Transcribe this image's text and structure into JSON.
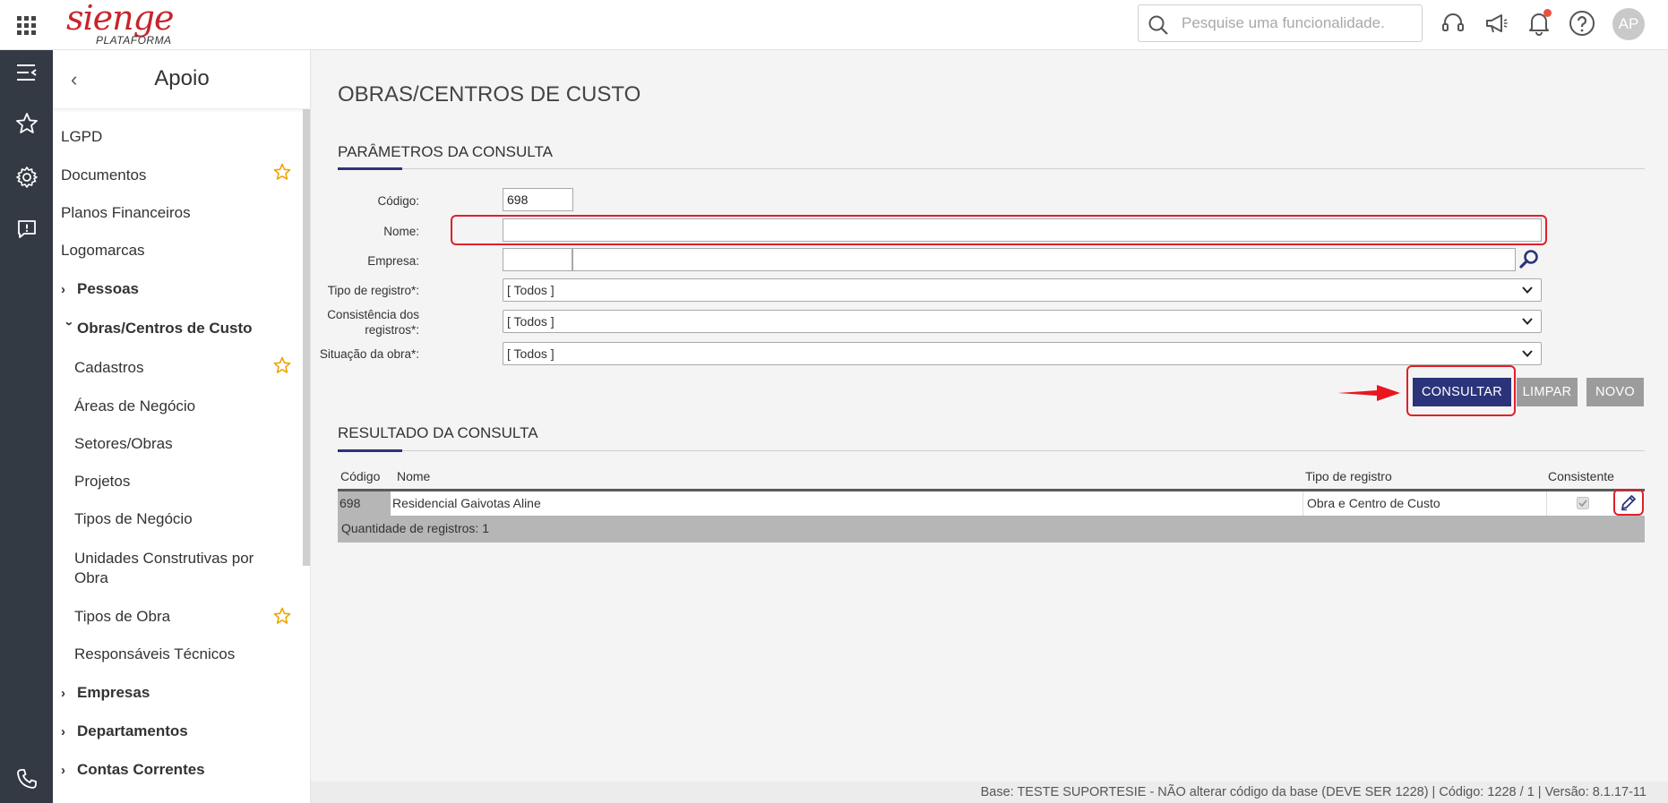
{
  "header": {
    "logo_main": "sienge",
    "logo_sub": "PLATAFORMA",
    "search_placeholder": "Pesquise uma funcionalidade.",
    "avatar_initials": "AP"
  },
  "sidemenu": {
    "title": "Apoio",
    "items": [
      {
        "label": "LGPD"
      },
      {
        "label": "Documentos"
      },
      {
        "label": "Planos Financeiros"
      },
      {
        "label": "Logomarcas"
      },
      {
        "label": "Pessoas"
      },
      {
        "label": "Obras/Centros de Custo"
      },
      {
        "label": "Cadastros"
      },
      {
        "label": "Áreas de Negócio"
      },
      {
        "label": "Setores/Obras"
      },
      {
        "label": "Projetos"
      },
      {
        "label": "Tipos de Negócio"
      },
      {
        "label": "Unidades Construtivas por"
      },
      {
        "label": "Obra"
      },
      {
        "label": "Tipos de Obra"
      },
      {
        "label": "Responsáveis Técnicos"
      },
      {
        "label": "Empresas"
      },
      {
        "label": "Departamentos"
      },
      {
        "label": "Contas Correntes"
      }
    ]
  },
  "main": {
    "page_title": "OBRAS/CENTROS DE CUSTO",
    "params_title": "PARÂMETROS DA CONSULTA",
    "fields": {
      "codigo_label": "Código:",
      "codigo_value": "698",
      "nome_label": "Nome:",
      "nome_value": "",
      "empresa_label": "Empresa:",
      "tipo_registro_label": "Tipo de registro*:",
      "tipo_registro_value": "[ Todos ]",
      "consistencia_label_1": "Consistência dos",
      "consistencia_label_2": "registros*:",
      "consistencia_value": "[ Todos ]",
      "situacao_label": "Situação da obra*:",
      "situacao_value": "[ Todos ]"
    },
    "buttons": {
      "consultar": "CONSULTAR",
      "limpar": "LIMPAR",
      "novo": "NOVO"
    },
    "results_title": "RESULTADO DA CONSULTA",
    "table": {
      "headers": [
        "Código",
        "Nome",
        "Tipo de registro",
        "Consistente"
      ],
      "rows": [
        {
          "codigo": "698",
          "nome": "Residencial Gaivotas Aline",
          "tipo": "Obra e Centro de Custo",
          "consistente": true
        }
      ],
      "footer": "Quantidade de registros: 1"
    }
  },
  "status_bar": "Base: TESTE SUPORTESIE - NÃO alterar código da base (DEVE SER 1228) | Código: 1228 / 1 | Versão: 8.1.17-11",
  "colors": {
    "brand_red": "#c8242b",
    "primary_button": "#2b347a",
    "secondary_button": "#9c9c9c",
    "rail_bg": "#333a44",
    "highlight": "#e0202a"
  }
}
